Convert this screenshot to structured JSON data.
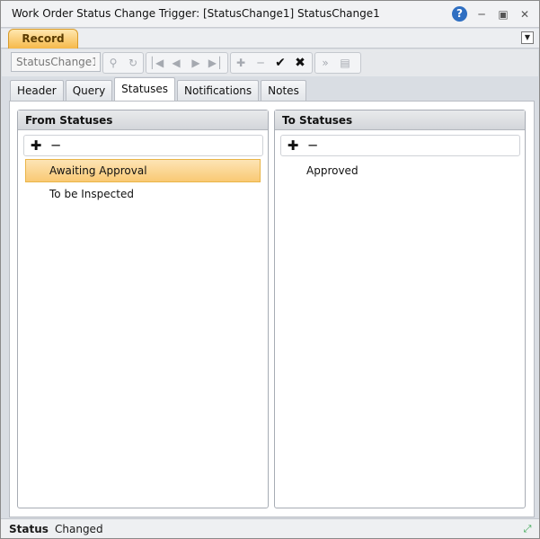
{
  "window": {
    "title": "Work Order Status Change Trigger: [StatusChange1] StatusChange1",
    "help_icon": "help-icon",
    "minimize_icon": "minimize-icon",
    "maximize_icon": "maximize-icon",
    "close_icon": "close-icon"
  },
  "record_tab": {
    "label": "Record"
  },
  "toolbar": {
    "search_value": "StatusChange1",
    "icons": [
      "search-icon",
      "refresh-icon",
      "first-record-icon",
      "previous-record-icon",
      "next-record-icon",
      "last-record-icon",
      "add-icon",
      "remove-icon",
      "confirm-icon",
      "cancel-icon",
      "fast-forward-icon",
      "notes-icon"
    ]
  },
  "tabs": [
    {
      "label": "Header"
    },
    {
      "label": "Query"
    },
    {
      "label": "Statuses"
    },
    {
      "label": "Notifications"
    },
    {
      "label": "Notes"
    }
  ],
  "from_statuses": {
    "title": "From Statuses",
    "items": [
      "Awaiting Approval",
      "To be Inspected"
    ]
  },
  "to_statuses": {
    "title": "To Statuses",
    "items": [
      "Approved"
    ]
  },
  "status_bar": {
    "label": "Status",
    "value": "Changed"
  },
  "colors": {
    "accent": "#f6b94a",
    "selection": "#f9c974",
    "help": "#2f6fc2"
  }
}
